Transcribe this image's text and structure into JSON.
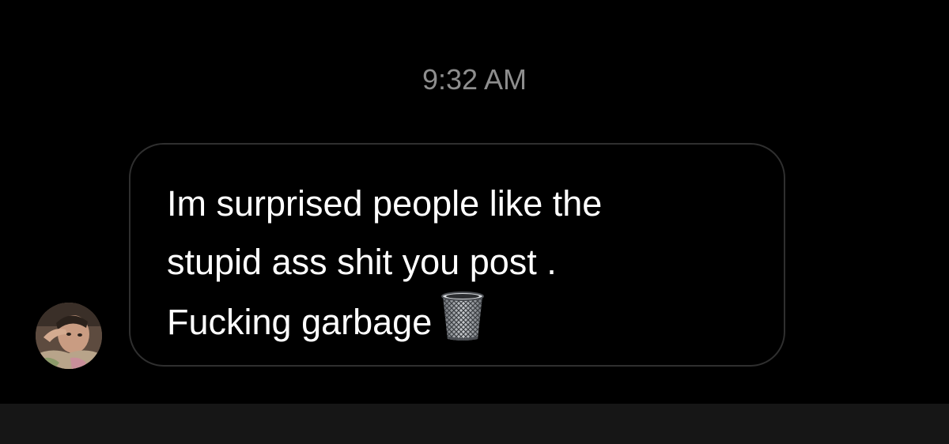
{
  "thread": {
    "timestamp": "9:32 AM",
    "message": {
      "text": "Im surprised people like the\nstupid ass shit you post .\nFucking garbage",
      "emoji_icon": "wastebasket-icon"
    }
  },
  "colors": {
    "background": "#000000",
    "timestamp": "#8e8e8e",
    "bubble_border": "#2f2f2f",
    "message_text": "#ffffff",
    "composer_bar": "#161616"
  }
}
